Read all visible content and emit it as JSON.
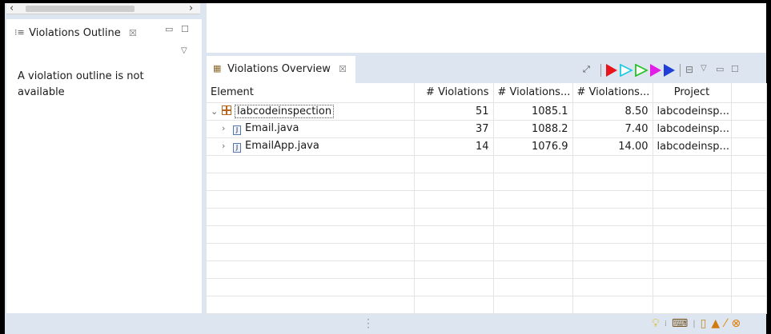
{
  "outline": {
    "tab_label": "Violations Outline",
    "tab_close": "☒",
    "message": "A violation outline is not available"
  },
  "overview": {
    "tab_label": "Violations Overview",
    "tab_close": "☒",
    "columns": [
      "Element",
      "# Violations",
      "# Violations...",
      "# Violations...",
      "Project"
    ],
    "rows": [
      {
        "element": "labcodeinspection",
        "type": "package",
        "expanded": true,
        "c1": "51",
        "c2": "1085.1",
        "c3": "8.50",
        "project": "labcodeinsp..."
      },
      {
        "element": "Email.java",
        "type": "java",
        "expanded": false,
        "c1": "37",
        "c2": "1088.2",
        "c3": "7.40",
        "project": "labcodeinsp..."
      },
      {
        "element": "EmailApp.java",
        "type": "java",
        "expanded": false,
        "c1": "14",
        "c2": "1076.9",
        "c3": "14.00",
        "project": "labcodeinsp..."
      }
    ],
    "toolbar_icons": [
      "collapse-icon",
      "red-priority-filter-icon",
      "cyan-priority-filter-icon",
      "green-priority-filter-icon",
      "magenta-priority-filter-icon",
      "blue-priority-filter-icon",
      "collapse-all-icon",
      "view-menu-icon",
      "minimize-icon",
      "maximize-icon"
    ]
  },
  "colors": {
    "red": "#e8141c",
    "cyan": "#1ecbe1",
    "green": "#22c322",
    "magenta": "#e21ee6",
    "blue": "#1f3fd6"
  },
  "status_bar": {
    "icons": [
      "lightbulb-icon",
      "code-review-icon",
      "book-icon",
      "graduation-cap-icon",
      "wand-icon",
      "sync-icon"
    ]
  }
}
